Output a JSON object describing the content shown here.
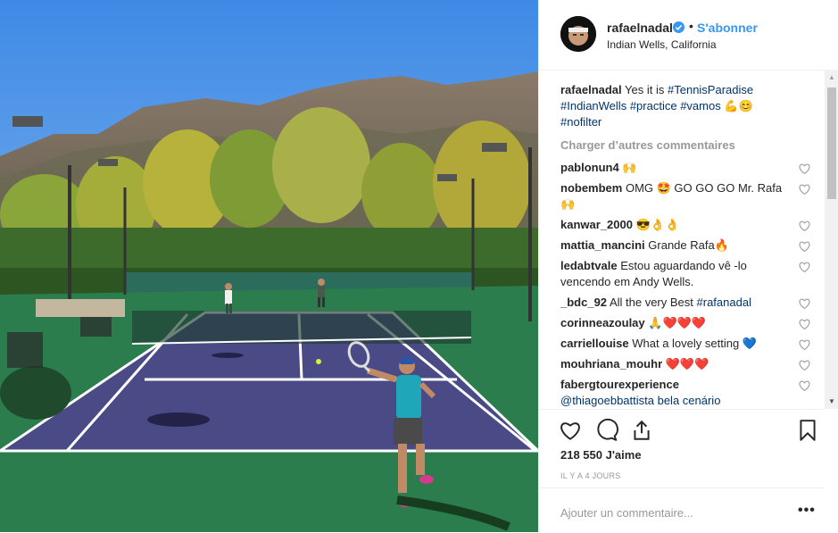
{
  "header": {
    "username": "rafaelnadal",
    "verified_icon": "verified-badge-icon",
    "separator": "•",
    "follow_label": "S'abonner",
    "location": "Indian Wells, California"
  },
  "caption": {
    "username": "rafaelnadal",
    "text": "Yes it is",
    "tags": [
      "#TennisParadise",
      "#IndianWells",
      "#practice",
      "#vamos"
    ],
    "emoji": "💪😊",
    "tag_last": "#nofilter"
  },
  "load_more_label": "Charger d’autres commentaires",
  "comments": [
    {
      "user": "pablonun4",
      "text": "🙌"
    },
    {
      "user": "nobembem",
      "text": "OMG 🤩 GO GO GO Mr. Rafa 🙌"
    },
    {
      "user": "kanwar_2000",
      "text": "😎👌👌"
    },
    {
      "user": "mattia_mancini",
      "text": "Grande Rafa🔥"
    },
    {
      "user": "ledabtvale",
      "text": "Estou aguardando vê -lo vencendo em Andy Wells."
    },
    {
      "user": "_bdc_92",
      "text": "All the very Best",
      "tag": "#rafanadal"
    },
    {
      "user": "corinneazoulay",
      "text": "🙏❤️❤️❤️"
    },
    {
      "user": "carriellouise",
      "text": "What a lovely setting 💙"
    },
    {
      "user": "mouhriana_mouhr",
      "text": "❤️❤️❤️"
    },
    {
      "user": "fabergtourexperience",
      "text": "@thiagoebbattista bela cenário"
    }
  ],
  "actions": {
    "like_icon": "heart-icon",
    "comment_icon": "comment-icon",
    "share_icon": "share-icon",
    "save_icon": "bookmark-icon"
  },
  "likes": "218 550 J'aime",
  "timestamp": "IL Y A 4 JOURS",
  "add_comment": {
    "placeholder": "Ajouter un commentaire...",
    "more_label": "•••"
  },
  "colors": {
    "link": "#3897f0",
    "hashtag": "#003569",
    "muted": "#999999",
    "court": "#4a4a86",
    "court_surround": "#2c7d4e"
  }
}
